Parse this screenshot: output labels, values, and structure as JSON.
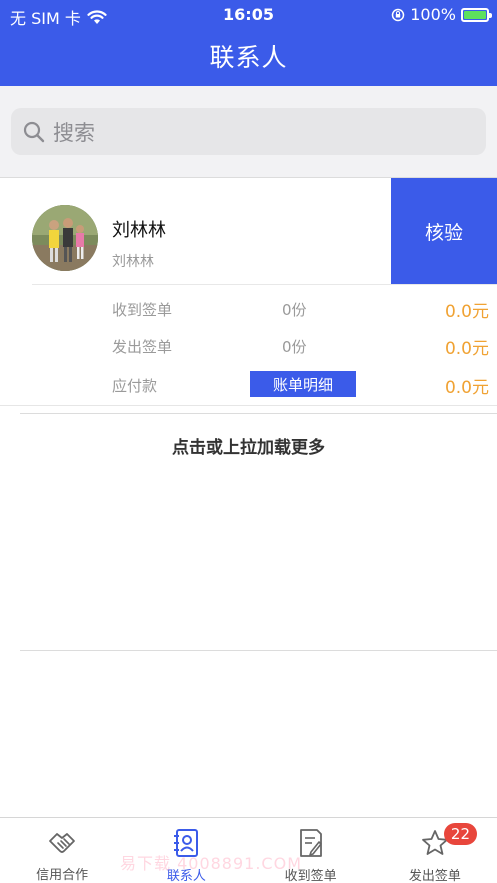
{
  "status_bar": {
    "carrier": "无 SIM 卡",
    "time": "16:05",
    "battery": "100%"
  },
  "nav": {
    "title": "联系人"
  },
  "search": {
    "placeholder": "搜索"
  },
  "contact": {
    "name": "刘林林",
    "subname": "刘林林",
    "verify_label": "核验",
    "rows": [
      {
        "label": "收到签单",
        "count": "0份",
        "amount": "0.0元"
      },
      {
        "label": "发出签单",
        "count": "0份",
        "amount": "0.0元"
      },
      {
        "label": "应付款",
        "button": "账单明细",
        "amount": "0.0元"
      }
    ]
  },
  "load_more": "点击或上拉加载更多",
  "tabs": [
    {
      "label": "信用合作",
      "icon": "handshake-icon",
      "active": false
    },
    {
      "label": "联系人",
      "icon": "contacts-icon",
      "active": true
    },
    {
      "label": "收到签单",
      "icon": "document-edit-icon",
      "active": false
    },
    {
      "label": "发出签单",
      "icon": "star-icon",
      "active": false,
      "badge": "22"
    }
  ],
  "watermark": "易下载  4008891.COM",
  "colors": {
    "primary": "#3b5be9",
    "amount": "#f0a233",
    "badge": "#e8463c"
  }
}
